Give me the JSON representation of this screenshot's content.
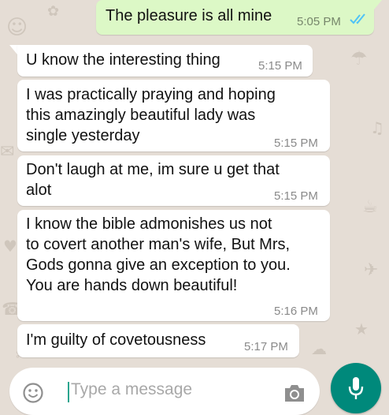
{
  "colors": {
    "wallpaper": "#e5ddd5",
    "incoming_bubble": "#ffffff",
    "outgoing_bubble": "#dcf8c6",
    "read_ticks": "#4fc3f7",
    "send_button": "#00897b"
  },
  "messages": [
    {
      "direction": "outgoing",
      "lines": [
        "The pleasure is all mine"
      ],
      "time": "5:05 PM",
      "status_icon": "double-check-icon"
    },
    {
      "direction": "incoming",
      "lines": [
        "U know the interesting thing"
      ],
      "time": "5:15 PM"
    },
    {
      "direction": "incoming",
      "lines": [
        "I was practically praying and hoping",
        "this amazingly beautiful lady was",
        "single yesterday"
      ],
      "time": "5:15 PM"
    },
    {
      "direction": "incoming",
      "lines": [
        "Don't laugh at me, im sure u get that",
        "alot"
      ],
      "time": "5:15 PM"
    },
    {
      "direction": "incoming",
      "lines": [
        "I know the bible admonishes us not",
        "to covert another man's wife, But Mrs,",
        "Gods gonna give an exception to you.",
        "You are hands down beautiful!"
      ],
      "time": "5:16 PM"
    },
    {
      "direction": "incoming",
      "lines": [
        "I'm guilty of covetousness"
      ],
      "time": "5:17 PM"
    }
  ],
  "composer": {
    "placeholder": "Type a message",
    "emoji_icon": "emoji-icon",
    "camera_icon": "camera-icon",
    "mic_icon": "microphone-icon"
  }
}
